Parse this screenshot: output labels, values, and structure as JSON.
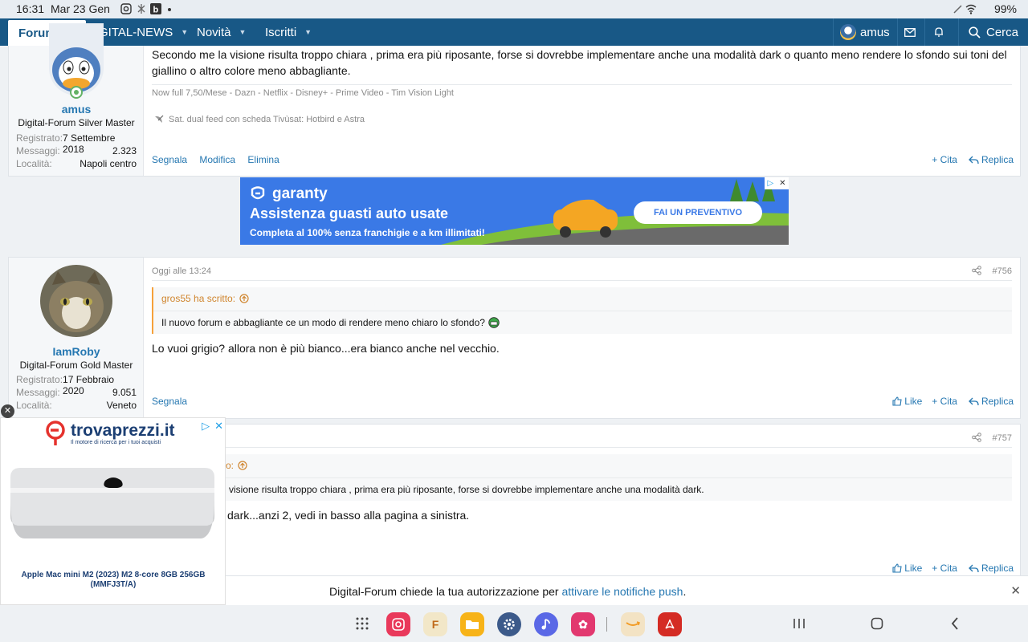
{
  "status": {
    "time": "16:31",
    "date": "Mar 23 Gen",
    "battery": "99%"
  },
  "nav": {
    "forum": "Forum",
    "digital_news": "DIGITAL-NEWS",
    "novita": "Novità",
    "iscritti": "Iscritti",
    "user": "amus",
    "search": "Cerca"
  },
  "post1": {
    "username": "amus",
    "title": "Digital-Forum Silver Master",
    "reg_label": "Registrato:",
    "reg_value": "7 Settembre 2018",
    "msg_label": "Messaggi:",
    "msg_value": "2.323",
    "loc_label": "Località:",
    "loc_value": "Napoli centro",
    "message": "Secondo me la visione risulta troppo chiara , prima era più riposante, forse si dovrebbe implementare anche una modalità dark o quanto meno rendere lo sfondo sui toni del giallino o altro colore meno abbagliante.",
    "sig1": "Now full 7,50/Mese - Dazn - Netflix - Disney+ - Prime Video - Tim Vision Light",
    "sig2": "Sat. dual feed con scheda Tivùsat: Hotbird e Astra",
    "segnala": "Segnala",
    "modifica": "Modifica",
    "elimina": "Elimina",
    "cita": "+ Cita",
    "replica": "Replica"
  },
  "ad_banner": {
    "brand": "garanty",
    "headline": "Assistenza guasti auto usate",
    "sub": "Completa al 100% senza franchigie e a km illimitati!",
    "cta": "FAI UN PREVENTIVO"
  },
  "post2": {
    "time": "Oggi alle 13:24",
    "number": "#756",
    "username": "IamRoby",
    "title": "Digital-Forum Gold Master",
    "reg_label": "Registrato:",
    "reg_value": "17 Febbraio 2020",
    "msg_label": "Messaggi:",
    "msg_value": "9.051",
    "loc_label": "Località:",
    "loc_value": "Veneto",
    "quote_author": "gros55 ha scritto:",
    "quote_text": "Il nuovo forum e abbagliante ce un modo di rendere meno chiaro lo sfondo?",
    "message": "Lo vuoi grigio? allora non è più bianco...era bianco anche nel vecchio.",
    "segnala": "Segnala",
    "like": "Like",
    "cita": "+ Cita",
    "replica": "Replica"
  },
  "post3": {
    "number": "#757",
    "quote_author": "o:",
    "quote_text": "visione risulta troppo chiara , prima era più riposante, forse si dovrebbe implementare anche una modalità dark.",
    "message": "dark...anzi 2, vedi in basso alla pagina a sinistra.",
    "like": "Like",
    "cita": "+ Cita",
    "replica": "Replica"
  },
  "ad_side": {
    "brand": "trovaprezzi.it",
    "tagline": "Il motore di ricerca per i tuoi acquisti",
    "product": "Apple Mac mini M2 (2023) M2 8-core 8GB 256GB (MMFJ3T/A)"
  },
  "push": {
    "text": "Digital-Forum chiede la tua autorizzazione per ",
    "link": "attivare le notifiche push",
    "end": "."
  },
  "colors": {
    "nav": "#185886",
    "link": "#2577b1",
    "quote_accent": "#f6a13a",
    "ad_blue": "#3a79e6"
  }
}
